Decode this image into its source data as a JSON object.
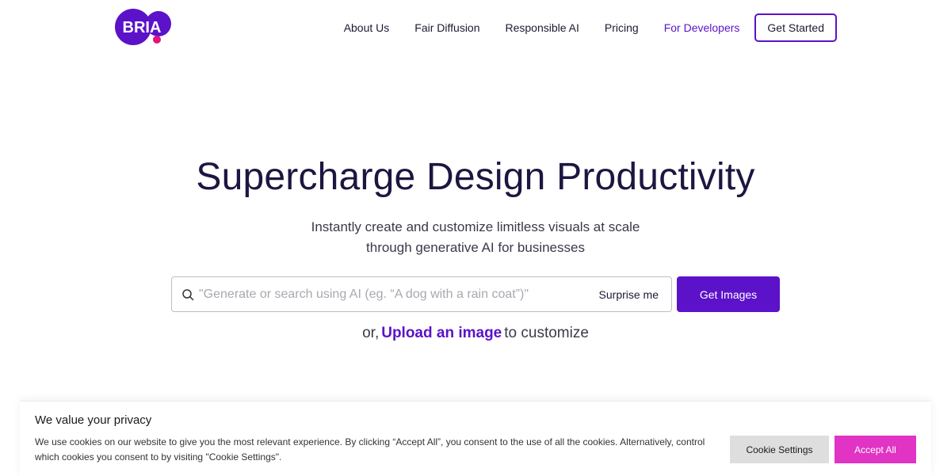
{
  "header": {
    "logo_text": "BRIA",
    "nav": [
      {
        "label": "About Us"
      },
      {
        "label": "Fair Diffusion"
      },
      {
        "label": "Responsible AI"
      },
      {
        "label": "Pricing"
      },
      {
        "label": "For Developers"
      }
    ],
    "cta_label": "Get Started"
  },
  "hero": {
    "title": "Supercharge Design Productivity",
    "subtitle_line1": "Instantly create and customize limitless visuals at scale",
    "subtitle_line2": "through generative AI for businesses"
  },
  "search": {
    "placeholder": "\"Generate or search using AI (eg. “A dog with a rain coat”)\"",
    "value": "",
    "surprise_label": "Surprise me",
    "submit_label": "Get Images"
  },
  "upload": {
    "prefix": "or,",
    "link_label": "Upload an image",
    "suffix": "to customize"
  },
  "cookie_banner": {
    "title": "We value your privacy",
    "text": "We use cookies on our website to give you the most relevant experience. By clicking “Accept All”, you consent to the use of all the cookies. Alternatively, control which cookies you consent to by visiting \"Cookie Settings\".",
    "settings_label": "Cookie Settings",
    "accept_label": "Accept All"
  },
  "colors": {
    "brand_purple": "#5b12c9",
    "accent_pink": "#e133c4",
    "text_dark": "#1c1640"
  }
}
